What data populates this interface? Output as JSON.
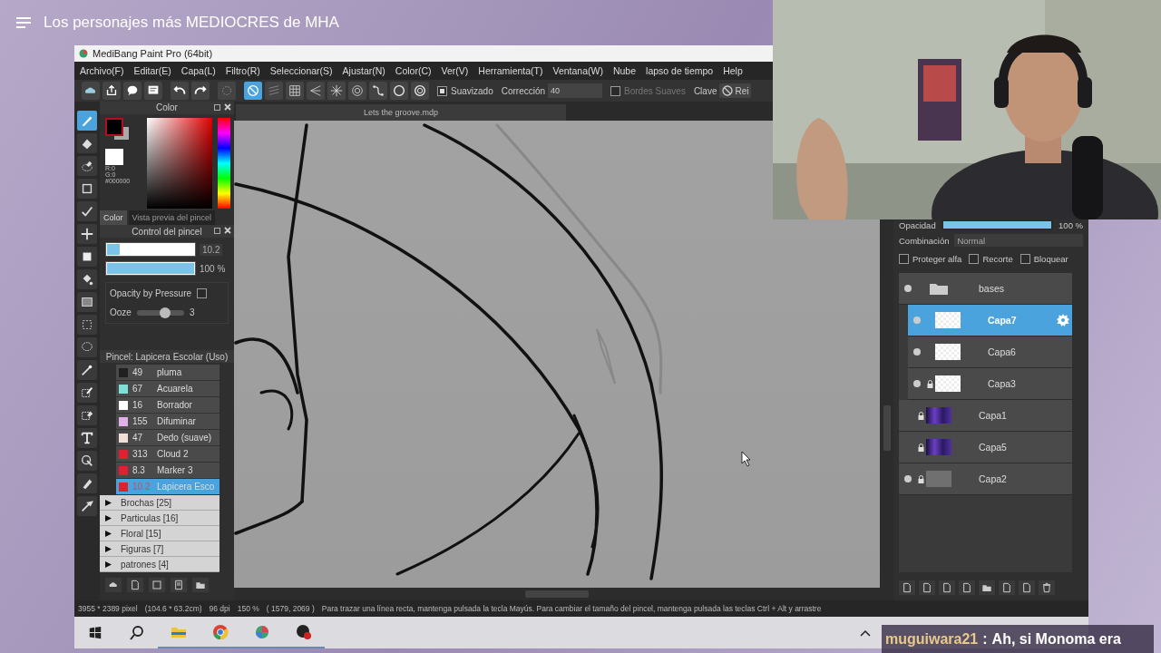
{
  "stream_title": "Los personajes más MEDIOCRES de MHA",
  "app": {
    "title": "MediBang Paint Pro (64bit)",
    "menu": [
      "Archivo(F)",
      "Editar(E)",
      "Capa(L)",
      "Filtro(R)",
      "Seleccionar(S)",
      "Ajustar(N)",
      "Color(C)",
      "Ver(V)",
      "Herramienta(T)",
      "Ventana(W)",
      "Nube",
      "lapso de tiempo",
      "Help"
    ],
    "toolbar": {
      "smoothing": {
        "label": "Suavizado",
        "checked": true
      },
      "correction_label": "Corrección",
      "correction_value": "40",
      "soft_edges": {
        "label": "Bordes Suaves",
        "checked": false
      },
      "key_label": "Clave",
      "reset_button": "Rei",
      "rulers": [
        {
          "selected": true
        },
        {
          "selected": false
        },
        {
          "selected": false
        },
        {
          "selected": false
        },
        {
          "selected": false
        },
        {
          "selected": false
        },
        {
          "selected": false
        },
        {
          "selected": false
        },
        {
          "selected": false
        }
      ]
    },
    "document_tab": "Lets the groove.mdp",
    "tools": [
      {
        "selected": true
      },
      {
        "selected": false
      },
      {
        "selected": false
      },
      {
        "selected": false
      },
      {
        "selected": false
      },
      {
        "selected": false
      },
      {
        "selected": false
      },
      {
        "selected": false
      },
      {
        "selected": false
      },
      {
        "selected": false
      },
      {
        "selected": false
      },
      {
        "selected": false
      },
      {
        "selected": false
      },
      {
        "selected": false
      },
      {
        "selected": false
      },
      {
        "selected": false
      },
      {
        "selected": false
      },
      {
        "selected": false
      }
    ],
    "color_panel": {
      "title": "Color",
      "readout": [
        "R:0",
        "G:0",
        "#000000"
      ],
      "tabs": [
        {
          "label": "Color",
          "selected": true
        },
        {
          "label": "Vista previa del pincel",
          "selected": false
        }
      ]
    },
    "brush_control": {
      "title": "Control del pincel",
      "size": {
        "level": 0.15,
        "value": "10.2"
      },
      "opacity": {
        "level": 1,
        "value": "100 %"
      },
      "opacity_by_pressure": {
        "label": "Opacity by Pressure",
        "checked": false
      },
      "ooze": {
        "label": "Ooze",
        "level": 0.6,
        "value": "3"
      }
    },
    "brush_panel": {
      "title": "Pincel: Lapicera Escolar (Uso)",
      "brushes": [
        {
          "size": "49",
          "name": "pluma",
          "color": "#202020",
          "selected": false
        },
        {
          "size": "67",
          "name": "Acuarela",
          "color": "#7fe0d8",
          "selected": false
        },
        {
          "size": "16",
          "name": "Borrador",
          "color": "#ffffff",
          "selected": false
        },
        {
          "size": "155",
          "name": "Difuminar",
          "color": "#e0b0e8",
          "selected": false
        },
        {
          "size": "47",
          "name": "Dedo (suave)",
          "color": "#f0e0d8",
          "selected": false
        },
        {
          "size": "313",
          "name": "Cloud 2",
          "color": "#e02030",
          "selected": false
        },
        {
          "size": "8.3",
          "name": "Marker 3",
          "color": "#e02030",
          "selected": false
        },
        {
          "size": "10.2",
          "name": "Lapicera Esco",
          "color": "#e02030",
          "selected": true
        }
      ],
      "groups": [
        {
          "label": "Brochas [25]",
          "expanded": false
        },
        {
          "label": "Particulas [16]",
          "expanded": false
        },
        {
          "label": "Floral [15]",
          "expanded": false
        },
        {
          "label": "Figuras [7]",
          "expanded": false
        },
        {
          "label": "patrones [4]",
          "expanded": false
        }
      ]
    },
    "layers": {
      "opacity_label": "Opacidad",
      "opacity": {
        "level": 1,
        "value": "100 %"
      },
      "blend_label": "Combinación",
      "blend": "Normal",
      "options": [
        {
          "label": "Proteger alfa",
          "checked": false
        },
        {
          "label": "Recorte",
          "checked": false
        },
        {
          "label": "Bloquear",
          "checked": false
        }
      ],
      "items": [
        {
          "name": "bases",
          "kind": "folder",
          "visible": true,
          "locked": false,
          "selected": false,
          "children": [
            {
              "name": "Capa7",
              "kind": "transparent",
              "visible": true,
              "locked": false,
              "selected": true
            },
            {
              "name": "Capa6",
              "kind": "transparent",
              "visible": true,
              "locked": false,
              "selected": false
            },
            {
              "name": "Capa3",
              "kind": "transparent",
              "visible": true,
              "locked": true,
              "selected": false
            }
          ]
        },
        {
          "name": "Capa1",
          "kind": "purple",
          "visible": false,
          "locked": true,
          "selected": false
        },
        {
          "name": "Capa5",
          "kind": "purple",
          "visible": false,
          "locked": true,
          "selected": false
        },
        {
          "name": "Capa2",
          "kind": "gray",
          "visible": true,
          "locked": true,
          "selected": false
        }
      ]
    },
    "status_bar": [
      "3955 * 2389 pixel",
      "(104.6 * 63.2cm)",
      "96 dpi",
      "150 %",
      "( 1579, 2069 )",
      "Para trazar una línea recta, mantenga pulsada la tecla Mayús. Para cambiar el tamaño del pincel, mantenga pulsada las teclas Ctrl + Alt y arrastre"
    ]
  },
  "chat": {
    "user": "muguiwara21",
    "separator": ":",
    "message": "Ah, si Monoma era"
  }
}
